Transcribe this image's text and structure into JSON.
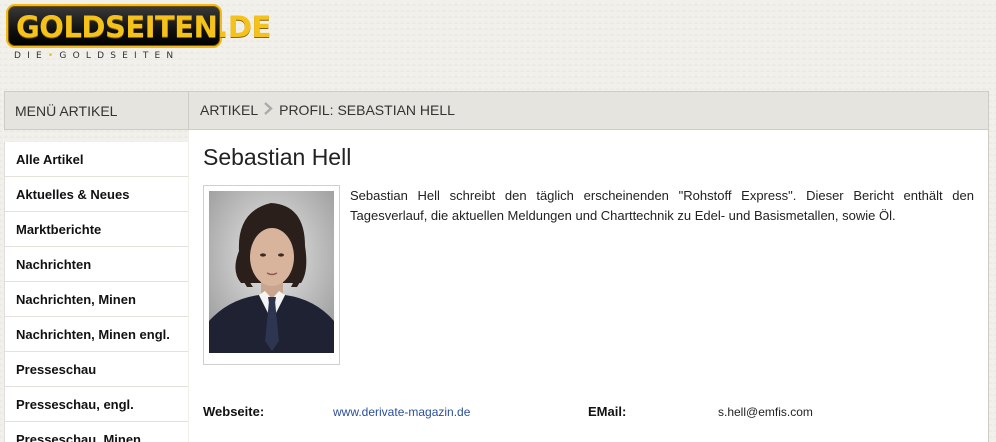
{
  "logo": {
    "text": "GOLDSEITEN.DE",
    "tagline_left": "DIE",
    "tagline_right": "GOLDSEITEN",
    "brand_color": "#f3b916"
  },
  "menu": {
    "header": "MENÜ ARTIKEL",
    "items": [
      {
        "label": "Alle Artikel"
      },
      {
        "label": "Aktuelles & Neues"
      },
      {
        "label": "Marktberichte"
      },
      {
        "label": "Nachrichten"
      },
      {
        "label": "Nachrichten, Minen"
      },
      {
        "label": "Nachrichten, Minen engl."
      },
      {
        "label": "Presseschau"
      },
      {
        "label": "Presseschau, engl."
      },
      {
        "label": "Presseschau, Minen"
      }
    ]
  },
  "breadcrumb": {
    "root": "ARTIKEL",
    "current": "PROFIL: SEBASTIAN HELL",
    "separator_icon": "chevron-right-icon"
  },
  "profile": {
    "name": "Sebastian Hell",
    "bio": "Sebastian Hell schreibt den täglich erscheinenden \"Rohstoff Express\". Dieser Bericht enthält den Tagesverlauf, die aktuellen Meldungen und Charttechnik zu Edel- und Basismetallen, sowie Öl.",
    "website_label": "Webseite:",
    "website_value": "www.derivate-magazin.de",
    "email_label": "EMail:",
    "email_value": "s.hell@emfis.com"
  },
  "colors": {
    "link": "#2a4f9a",
    "header_bg": "#e6e4df"
  }
}
